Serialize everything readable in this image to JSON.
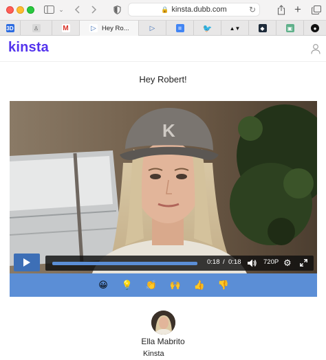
{
  "browser": {
    "address_domain": "kinsta.dubb.com",
    "tabs": [
      {
        "icon": "three-d-icon",
        "label": ""
      },
      {
        "icon": "person-icon",
        "label": ""
      },
      {
        "icon": "gmail-icon",
        "label": ""
      },
      {
        "icon": "dubb-icon",
        "label": "Hey Ro...",
        "active": true
      },
      {
        "icon": "dubb-icon",
        "label": ""
      },
      {
        "icon": "docs-icon",
        "label": ""
      },
      {
        "icon": "twitter-icon",
        "label": ""
      },
      {
        "icon": "av-icon",
        "label": ""
      },
      {
        "icon": "cube-icon",
        "label": ""
      },
      {
        "icon": "app-icon",
        "label": ""
      },
      {
        "icon": "github-icon",
        "label": ""
      }
    ]
  },
  "site": {
    "logo": "kinsta",
    "greeting": "Hey Robert!"
  },
  "video": {
    "current_time": "0:18",
    "separator": "/",
    "duration": "0:18",
    "quality": "720P",
    "progress": 1.0
  },
  "reactions": [
    "😀",
    "💡",
    "👏",
    "🙌",
    "👍",
    "👎"
  ],
  "sender": {
    "name": "Ella Mabrito",
    "company": "Kinsta"
  },
  "colors": {
    "brand": "#5333ed",
    "reaction_bar": "#5b8ed6",
    "play_button": "#3d6fb6"
  }
}
